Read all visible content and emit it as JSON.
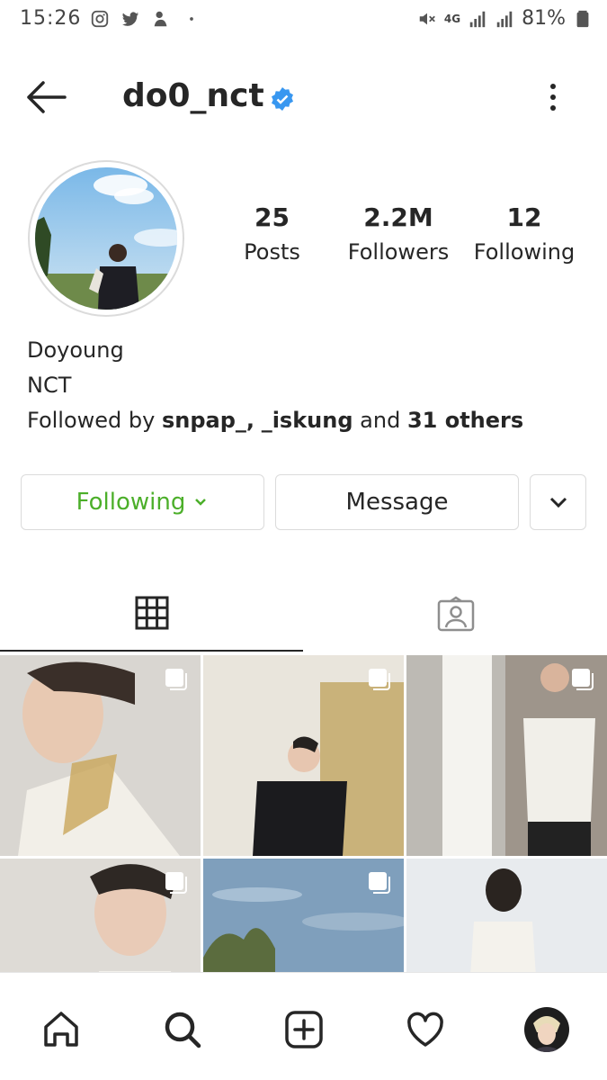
{
  "status_bar": {
    "time": "15:26",
    "battery": "81%",
    "network": "4G"
  },
  "header": {
    "username": "do0_nct",
    "verified": true,
    "back_icon": "arrow-left-icon",
    "more_icon": "more-vertical-icon"
  },
  "profile": {
    "stats": [
      {
        "value": "25",
        "label": "Posts"
      },
      {
        "value": "2.2M",
        "label": "Followers"
      },
      {
        "value": "12",
        "label": "Following"
      }
    ],
    "name": "Doyoung",
    "bio_line": "NCT",
    "followed_by_prefix": "Followed by",
    "followed_by_user1": "snpap_,",
    "followed_by_user2": "_iskung",
    "followed_by_and": "and",
    "followed_by_others": "31 others"
  },
  "actions": {
    "following_label": "Following",
    "message_label": "Message"
  },
  "tabs": {
    "grid_icon": "grid-icon",
    "tagged_icon": "tagged-icon"
  },
  "colors": {
    "following_green": "#4caf2a",
    "verified_blue": "#3897f0",
    "text": "#262626",
    "border": "#dbdbdb"
  },
  "bottom_nav": [
    "home-icon",
    "search-icon",
    "add-post-icon",
    "activity-heart-icon",
    "profile-avatar-icon"
  ]
}
